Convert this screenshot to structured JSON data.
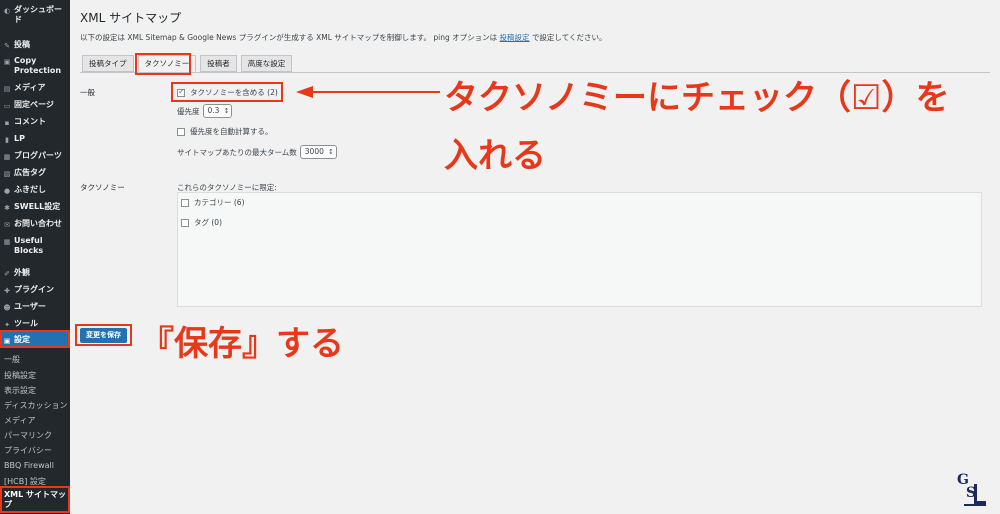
{
  "sidebar": {
    "items": [
      {
        "label": "ダッシュボー\nド",
        "icon": "dashboard-icon"
      },
      {
        "label": "投稿",
        "icon": "pin-icon"
      },
      {
        "label": "Copy\nProtection",
        "icon": "shield-icon"
      },
      {
        "label": "メディア",
        "icon": "media-icon"
      },
      {
        "label": "固定ページ",
        "icon": "page-icon"
      },
      {
        "label": "コメント",
        "icon": "comment-icon"
      },
      {
        "label": "LP",
        "icon": "page-icon"
      },
      {
        "label": "ブログパーツ",
        "icon": "block-icon"
      },
      {
        "label": "広告タグ",
        "icon": "ad-icon"
      },
      {
        "label": "ふきだし",
        "icon": "balloon-icon"
      },
      {
        "label": "SWELL設定",
        "icon": "gear-icon"
      },
      {
        "label": "お問い合わせ",
        "icon": "mail-icon"
      },
      {
        "label": "Useful\nBlocks",
        "icon": "block-icon"
      },
      {
        "label": "外観",
        "icon": "brush-icon"
      },
      {
        "label": "プラグイン",
        "icon": "plugin-icon"
      },
      {
        "label": "ユーザー",
        "icon": "user-icon"
      },
      {
        "label": "ツール",
        "icon": "wrench-icon"
      },
      {
        "label": "設定",
        "icon": "settings-icon"
      }
    ],
    "submenu": [
      "一般",
      "投稿設定",
      "表示設定",
      "ディスカッション",
      "メディア",
      "パーマリンク",
      "プライバシー",
      "BBQ Firewall",
      "[HCB] 設定",
      "XML サイトマッ\nプ"
    ]
  },
  "page": {
    "title": "XML サイトマップ",
    "description_prefix": "以下の設定は XML Sitemap & Google News プラグインが生成する XML サイトマップを制御します。 ping オプションは",
    "description_link": "投稿設定",
    "description_suffix": "で設定してください。"
  },
  "tabs": [
    "投稿タイプ",
    "タクソノミー",
    "投稿者",
    "高度な設定"
  ],
  "general": {
    "label": "一般",
    "include_taxonomies": "タクソノミーを含める (2)",
    "priority_label": "優先度",
    "priority_value": "0.3",
    "auto_priority": "優先度を自動計算する。",
    "max_terms_label": "サイトマップあたりの最大ターム数",
    "max_terms_value": "3000"
  },
  "taxonomies": {
    "label": "タクソノミー",
    "limit_label": "これらのタクソノミーに限定:",
    "items": [
      "カテゴリー (6)",
      "タグ (0)"
    ]
  },
  "save_button": "変更を保存",
  "annotations": {
    "check_line1": "タクソノミーにチェック（☑）を",
    "check_line2": "入れる",
    "save": "『保存』する"
  },
  "colors": {
    "accent": "#2271b1",
    "annotation": "#e8381a",
    "sidebar": "#23282d"
  }
}
